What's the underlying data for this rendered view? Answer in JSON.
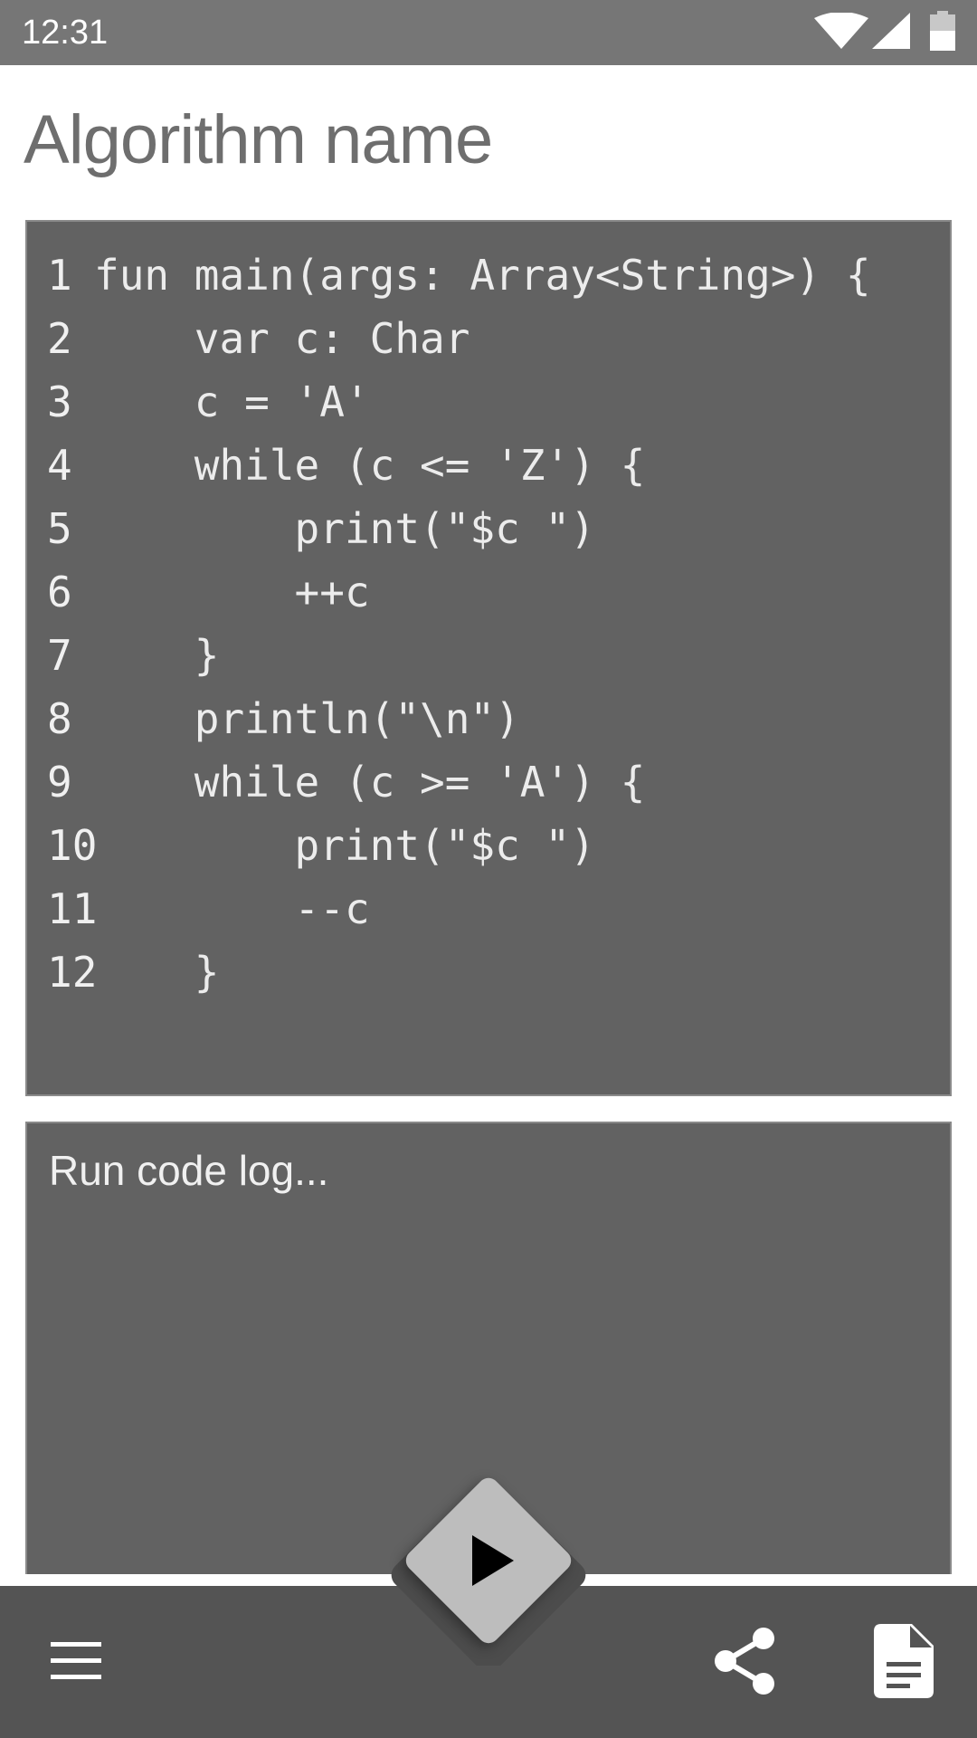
{
  "status_bar": {
    "time": "12:31",
    "icons": [
      "wifi-icon",
      "signal-icon",
      "battery-icon"
    ]
  },
  "title": "Algorithm name",
  "editor": {
    "lines": [
      {
        "number": "1",
        "code": "fun main(args: Array<String>) {"
      },
      {
        "number": "2",
        "code": "    var c: Char"
      },
      {
        "number": "3",
        "code": "    c = 'A'"
      },
      {
        "number": "4",
        "code": "    while (c <= 'Z') {"
      },
      {
        "number": "5",
        "code": "        print(\"$c \")"
      },
      {
        "number": "6",
        "code": "        ++c"
      },
      {
        "number": "7",
        "code": "    }"
      },
      {
        "number": "8",
        "code": "    println(\"\\n\")"
      },
      {
        "number": "9",
        "code": "    while (c >= 'A') {"
      },
      {
        "number": "10",
        "code": "        print(\"$c \")"
      },
      {
        "number": "11",
        "code": "        --c"
      },
      {
        "number": "12",
        "code": "    }"
      }
    ]
  },
  "run_log": {
    "placeholder": "Run code log..."
  },
  "bottom_bar": {
    "icons": [
      "menu-icon",
      "play-icon",
      "share-icon",
      "document-icon"
    ]
  },
  "colors": {
    "status_bar": "#767676",
    "title": "#6e6e6e",
    "panel_background": "#626262",
    "bottom_bar": "#545454",
    "fab": "#bdbdbd"
  }
}
